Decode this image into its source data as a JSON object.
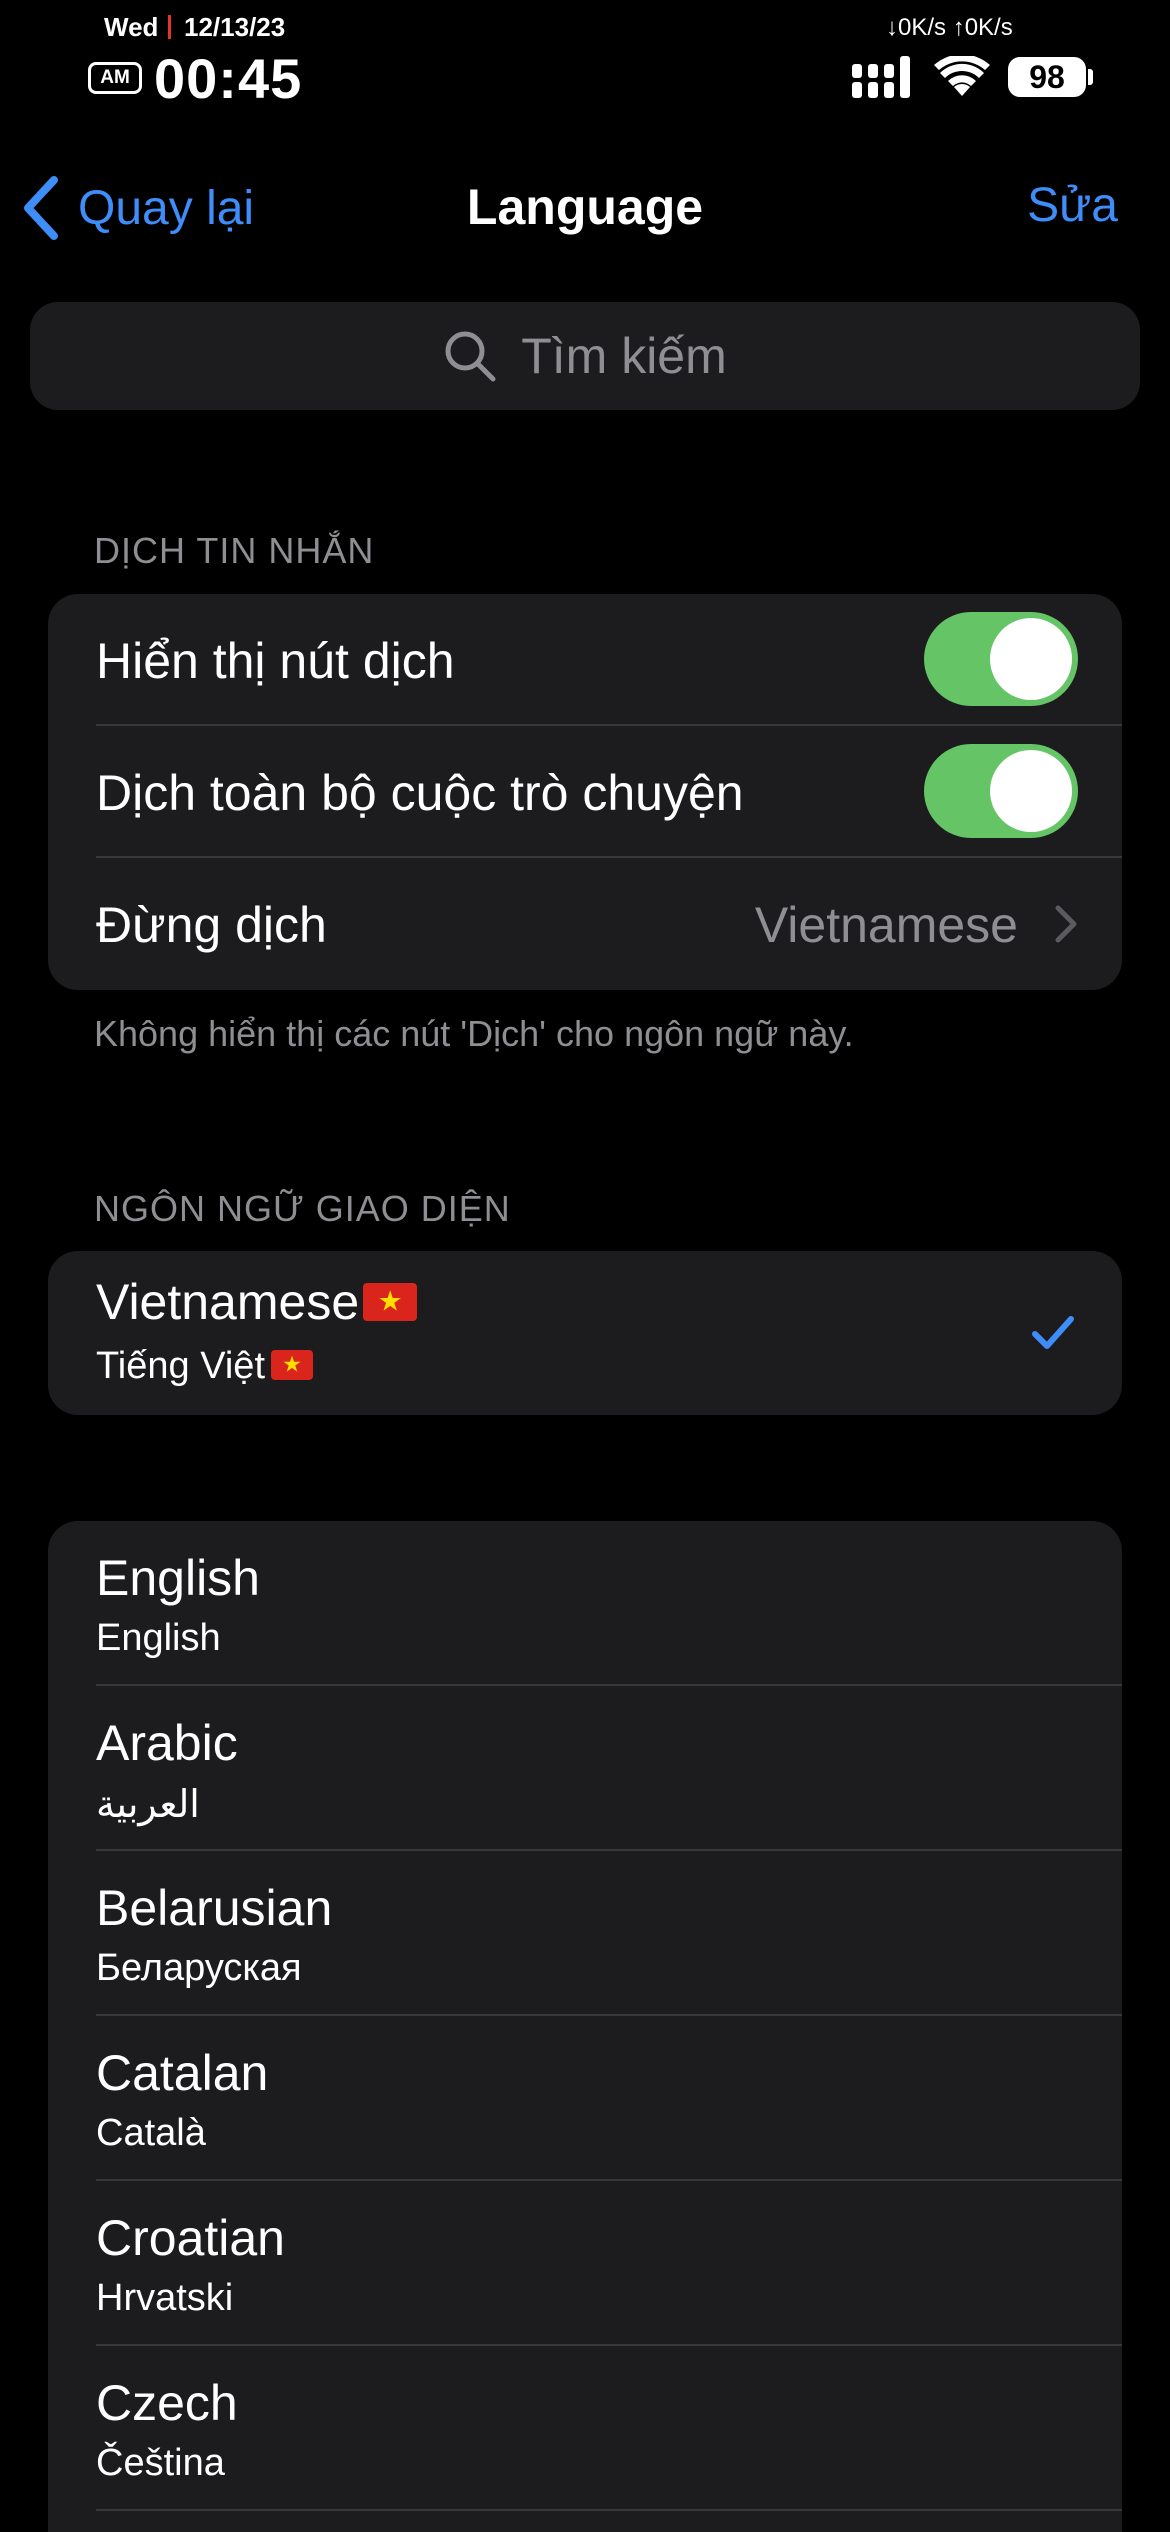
{
  "status_bar": {
    "day": "Wed",
    "date": "12/13/23",
    "ampm": "AM",
    "time": "00:45",
    "net_speed": "↓0K/s ↑0K/s",
    "battery": "98",
    "icons": [
      "signal-icon",
      "wifi-icon",
      "battery-icon"
    ]
  },
  "nav": {
    "back_label": "Quay lại",
    "title": "Language",
    "edit_label": "Sửa"
  },
  "search": {
    "placeholder": "Tìm kiếm"
  },
  "translate_section": {
    "header": "DỊCH TIN NHẮN",
    "show_button_label": "Hiển thị nút dịch",
    "show_button_on": true,
    "translate_chats_label": "Dịch toàn bộ cuộc trò chuyện",
    "translate_chats_on": true,
    "do_not_translate_label": "Đừng dịch",
    "do_not_translate_value": "Vietnamese",
    "footnote": "Không hiển thị các nút 'Dịch' cho ngôn ngữ này."
  },
  "interface_section": {
    "header": "NGÔN NGỮ GIAO DIỆN",
    "selected": {
      "name": "Vietnamese",
      "native": "Tiếng Việt",
      "flag": "vietnam-flag-icon"
    }
  },
  "languages": [
    {
      "name": "English",
      "native": "English"
    },
    {
      "name": "Arabic",
      "native": "العربية"
    },
    {
      "name": "Belarusian",
      "native": "Беларуская"
    },
    {
      "name": "Catalan",
      "native": "Català"
    },
    {
      "name": "Croatian",
      "native": "Hrvatski"
    },
    {
      "name": "Czech",
      "native": "Čeština"
    }
  ],
  "colors": {
    "accent": "#3e8df8",
    "toggle_on": "#65c466",
    "cell_bg": "#1c1c1e",
    "secondary_text": "#8e8e93"
  }
}
